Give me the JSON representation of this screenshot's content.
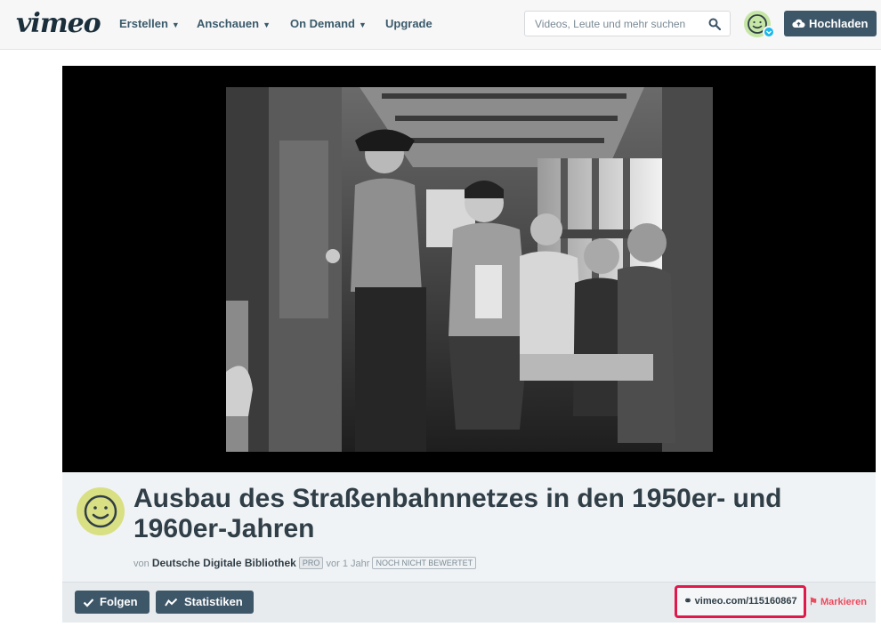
{
  "nav": {
    "logo": "vimeo",
    "items": [
      {
        "label": "Erstellen",
        "has_dropdown": true
      },
      {
        "label": "Anschauen",
        "has_dropdown": true
      },
      {
        "label": "On Demand",
        "has_dropdown": true
      },
      {
        "label": "Upgrade",
        "has_dropdown": false
      }
    ],
    "search_placeholder": "Videos, Leute und mehr suchen",
    "upload_label": "Hochladen",
    "icons": {
      "search": "search-icon",
      "upload": "cloud-upload-icon",
      "avatar_badge": "chevron-down-icon"
    }
  },
  "video": {
    "title": "Ausbau des Straßenbahnnetzes in den 1950er- und 1960er-Jahren",
    "by_prefix": "von",
    "owner": "Deutsche Digitale Bibliothek",
    "pro_badge": "PRO",
    "age": "vor 1 Jahr",
    "rating_badge": "NOCH NICHT BEWERTET"
  },
  "actions": {
    "follow_label": "Folgen",
    "stats_label": "Statistiken",
    "short_url": "vimeo.com/115160867",
    "flag_label": "Markieren"
  },
  "colors": {
    "accent_dark": "#3d5668",
    "highlight": "#e0194c",
    "flag": "#ef4a5d",
    "avatar": "#d9df83"
  }
}
